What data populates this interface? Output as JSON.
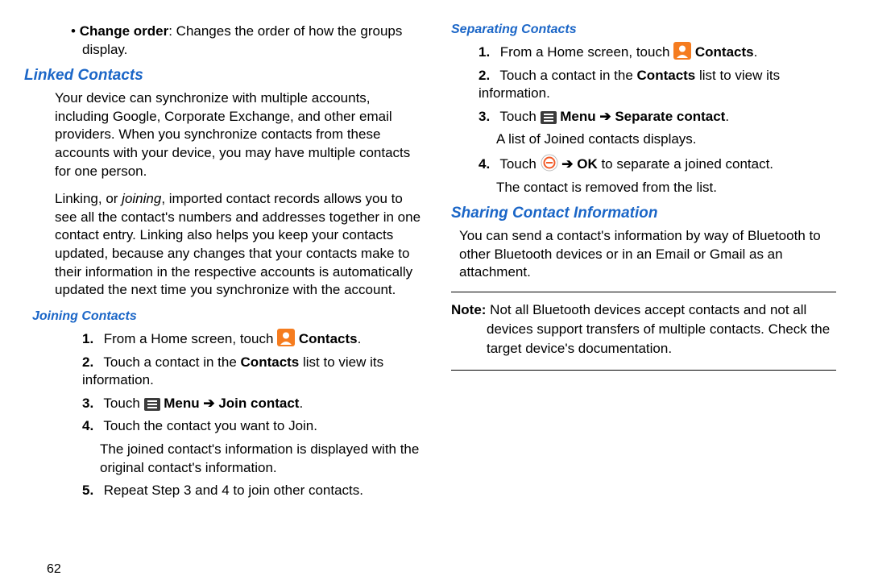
{
  "left": {
    "bullet": {
      "label": "Change order",
      "rest": ": Changes the order of how the groups display."
    },
    "linked_heading": "Linked Contacts",
    "linked_p1": "Your device can synchronize with multiple accounts, including Google, Corporate Exchange, and other email providers. When you synchronize contacts from these accounts with your device, you may have multiple contacts for one person.",
    "linked_p2a": "Linking, or ",
    "linked_p2b": "joining",
    "linked_p2c": ", imported contact records allows you to see all the contact's numbers and addresses together in one contact entry. Linking also helps you keep your contacts updated, because any changes that your contacts make to their information in the respective accounts is automatically updated the next time you synchronize with the account.",
    "joining_heading": "Joining Contacts",
    "steps": {
      "s1_a": "From a Home screen, touch ",
      "s1_b": "Contacts",
      "s1_c": ".",
      "s2_a": "Touch a contact in the ",
      "s2_b": "Contacts",
      "s2_c": " list to view its information.",
      "s3_a": "Touch ",
      "s3_menu": "Menu",
      "s3_arrow": " ➔ ",
      "s3_join": "Join contact",
      "s3_c": ".",
      "s4": "Touch the contact you want to Join.",
      "s4_cont": "The joined contact's information is displayed with the original contact's information.",
      "s5": "Repeat Step 3 and 4 to join other contacts."
    }
  },
  "right": {
    "separating_heading": "Separating Contacts",
    "steps": {
      "s1_a": "From a Home screen, touch ",
      "s1_b": "Contacts",
      "s1_c": ".",
      "s2_a": "Touch a contact in the ",
      "s2_b": "Contacts",
      "s2_c": " list to view its information.",
      "s3_a": "Touch ",
      "s3_menu": "Menu",
      "s3_arrow": " ➔ ",
      "s3_sep": "Separate contact",
      "s3_c": ".",
      "s3_cont": "A list of Joined contacts displays.",
      "s4_a": "Touch ",
      "s4_arrow": " ➔ ",
      "s4_ok": "OK",
      "s4_b": " to separate a joined contact.",
      "s4_cont": "The contact is removed from the list."
    },
    "sharing_heading": "Sharing Contact Information",
    "sharing_p1": "You can send a contact's information by way of Bluetooth to other Bluetooth devices or in an Email or Gmail as an attachment.",
    "note_label": "Note:",
    "note_body": " Not all Bluetooth devices accept contacts and not all devices support transfers of multiple contacts. Check the target device's documentation."
  },
  "page_number": "62"
}
